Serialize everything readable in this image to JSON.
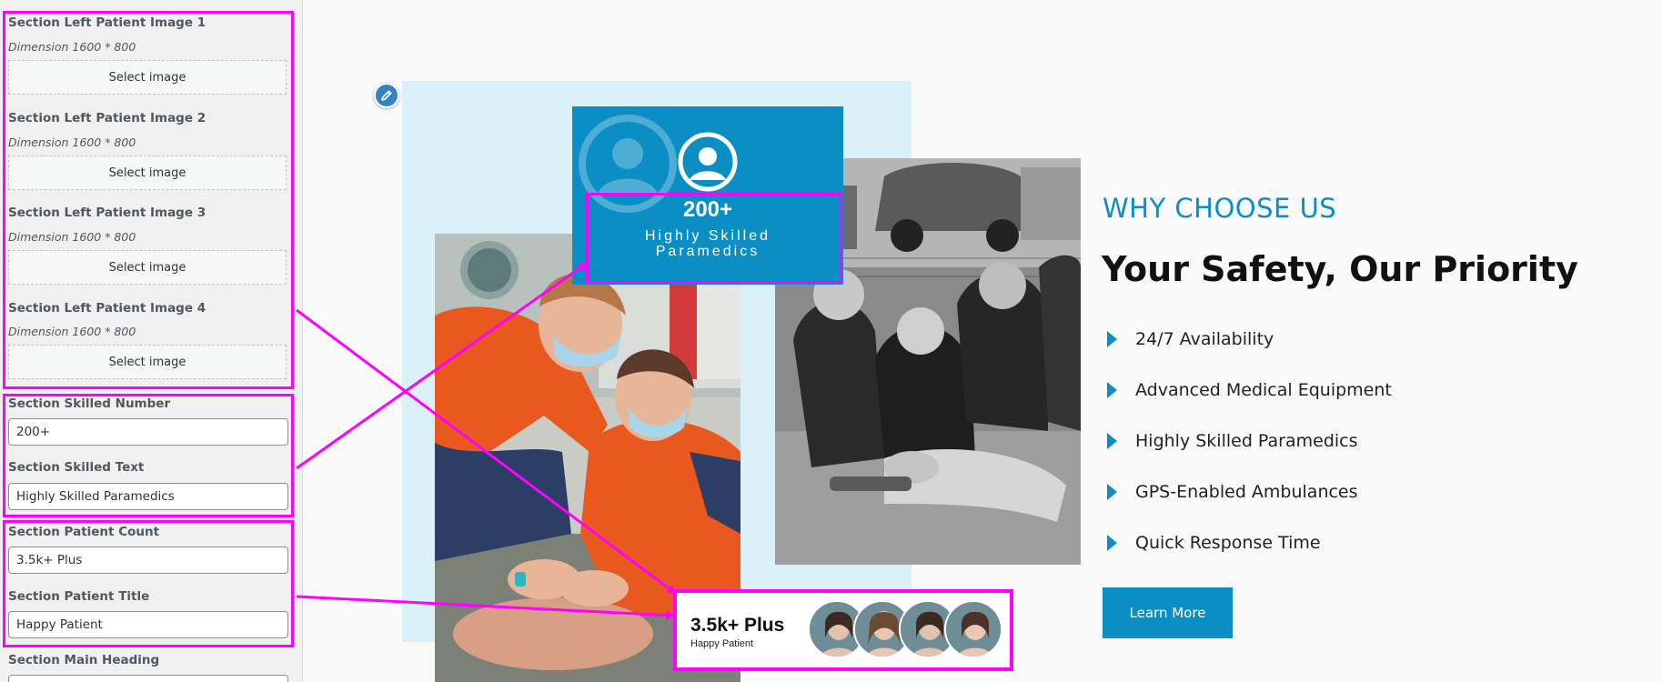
{
  "panel": {
    "image_fields": [
      {
        "label": "Section Left Patient Image 1",
        "dimension": "Dimension 1600 * 800",
        "button": "Select image"
      },
      {
        "label": "Section Left Patient Image 2",
        "dimension": "Dimension 1600 * 800",
        "button": "Select image"
      },
      {
        "label": "Section Left Patient Image 3",
        "dimension": "Dimension 1600 * 800",
        "button": "Select image"
      },
      {
        "label": "Section Left Patient Image 4",
        "dimension": "Dimension 1600 * 800",
        "button": "Select image"
      }
    ],
    "skilled_number": {
      "label": "Section Skilled Number",
      "value": "200+"
    },
    "skilled_text": {
      "label": "Section Skilled Text",
      "value": "Highly Skilled Paramedics"
    },
    "patient_count": {
      "label": "Section Patient Count",
      "value": "3.5k+ Plus"
    },
    "patient_title": {
      "label": "Section Patient Title",
      "value": "Happy Patient"
    },
    "main_heading": {
      "label": "Section Main Heading"
    }
  },
  "preview": {
    "skilled_number": "200+",
    "skilled_text": "Highly Skilled Paramedics",
    "patient_count": "3.5k+ Plus",
    "patient_title": "Happy Patient",
    "why_label": "WHY CHOOSE US",
    "heading": "Your Safety, Our Priority",
    "features": [
      "24/7 Availability",
      "Advanced Medical Equipment",
      "Highly Skilled Paramedics",
      "GPS-Enabled Ambulances",
      "Quick Response Time"
    ],
    "button": "Learn More"
  },
  "icons": {
    "edit": "pencil-icon",
    "user": "user-circle-icon",
    "feature_bullet": "triangle-right-icon"
  },
  "colors": {
    "accent": "#0a8ec4",
    "highlight": "#ff00ff",
    "light_block": "#dbf1f9",
    "panel_bg": "#f0f0f1"
  }
}
